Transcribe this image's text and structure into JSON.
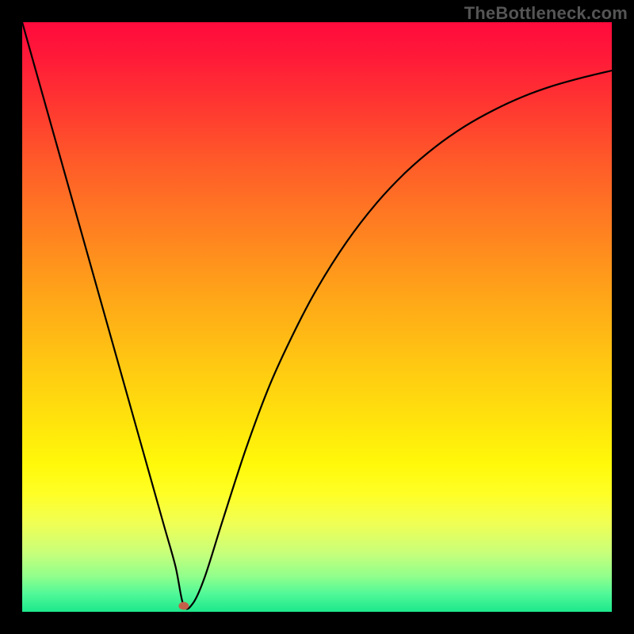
{
  "watermark": "TheBottleneck.com",
  "chart_data": {
    "type": "line",
    "title": "",
    "xlabel": "",
    "ylabel": "",
    "xlim": [
      0,
      1
    ],
    "ylim": [
      0,
      1
    ],
    "grid": false,
    "legend": false,
    "background_gradient": {
      "top": "#ff0a3c",
      "middle": "#ffe40c",
      "bottom": "#1ce88c"
    },
    "series": [
      {
        "name": "bottleneck-curve",
        "x": [
          0.0,
          0.04,
          0.08,
          0.12,
          0.16,
          0.2,
          0.24,
          0.26,
          0.274,
          0.29,
          0.31,
          0.34,
          0.38,
          0.42,
          0.46,
          0.5,
          0.55,
          0.6,
          0.65,
          0.7,
          0.75,
          0.8,
          0.85,
          0.9,
          0.95,
          1.0
        ],
        "y": [
          1.0,
          0.858,
          0.716,
          0.574,
          0.432,
          0.29,
          0.148,
          0.077,
          0.01,
          0.015,
          0.06,
          0.155,
          0.278,
          0.385,
          0.472,
          0.548,
          0.627,
          0.692,
          0.745,
          0.788,
          0.823,
          0.851,
          0.874,
          0.892,
          0.906,
          0.918
        ]
      }
    ],
    "marker": {
      "x": 0.274,
      "y": 0.01,
      "color": "#c4604a"
    }
  }
}
